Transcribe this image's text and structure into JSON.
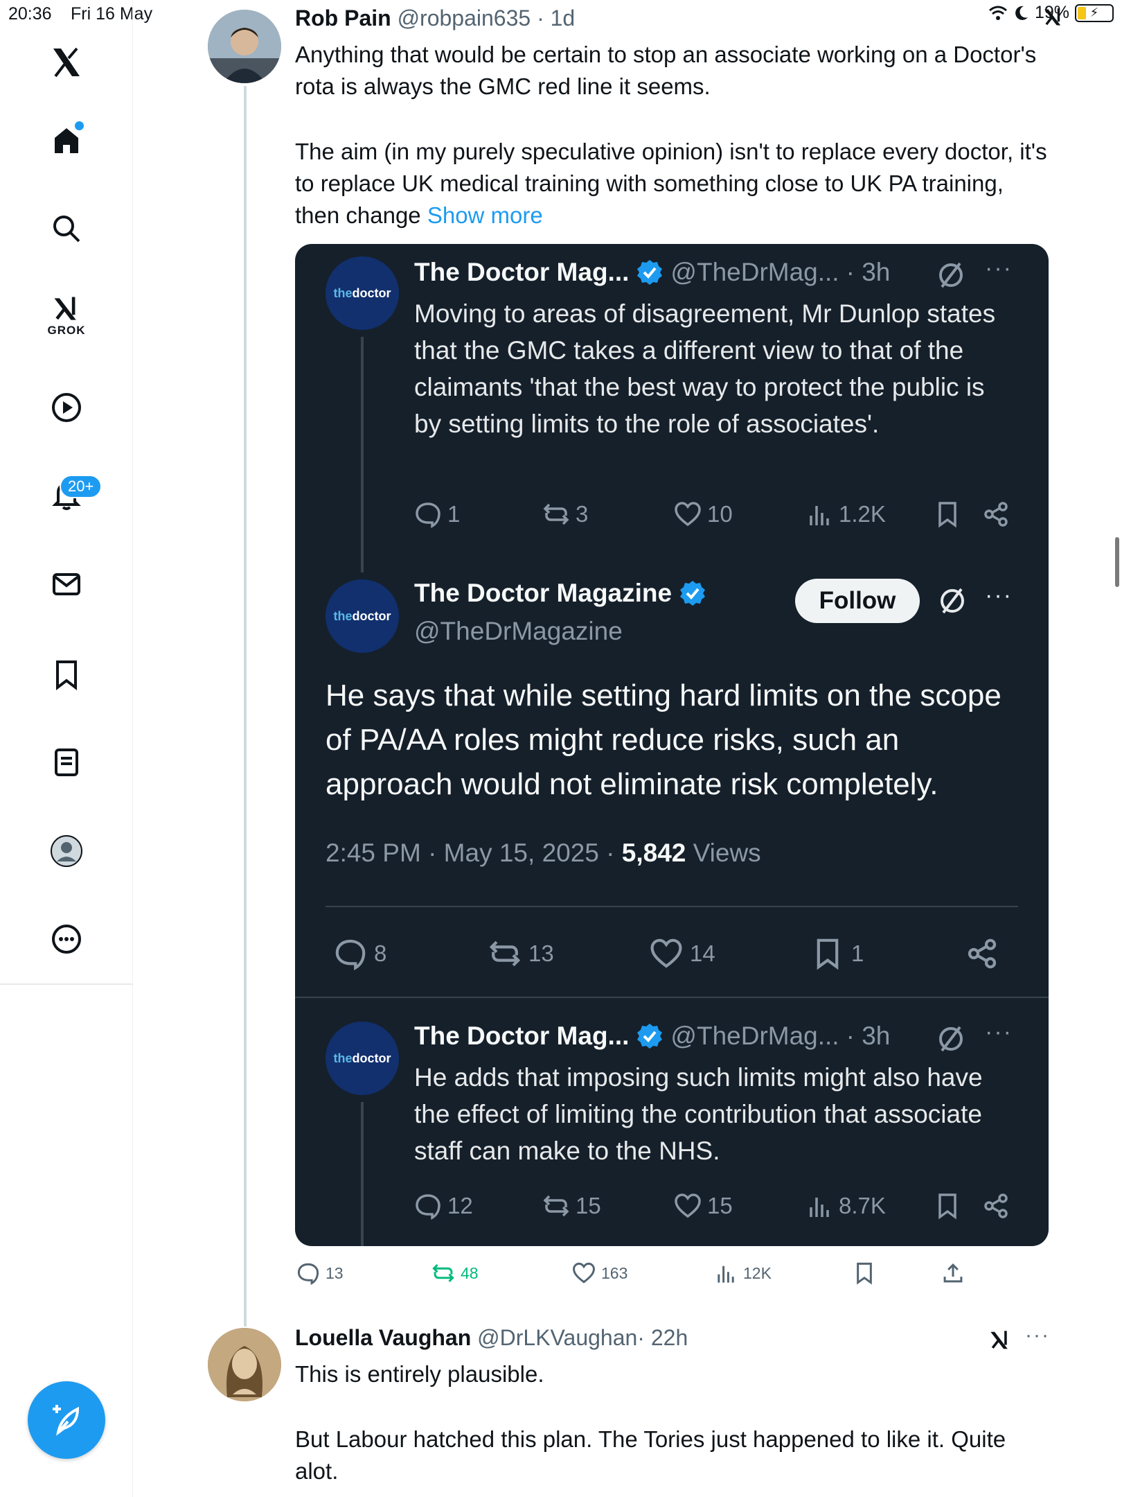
{
  "status_bar": {
    "time": "20:36",
    "date": "Fri 16 May",
    "battery": "19%"
  },
  "nav": {
    "grok_label": "GROK",
    "notifications_badge": "20+"
  },
  "tweet": {
    "name": "Rob Pain",
    "handle": "@robpain635",
    "time": "· 1d",
    "text_p1": "Anything that would be certain to stop an associate working on a Doctor's rota is always the GMC red line it seems.",
    "text_p2": "The aim (in my purely speculative opinion) isn't to replace every doctor, it's to replace UK medical training with something close to UK PA training, then change",
    "show_more": "Show more",
    "actions": {
      "replies": "13",
      "reposts": "48",
      "likes": "163",
      "views": "12K"
    }
  },
  "quote": {
    "avatar_text_a": "the",
    "avatar_text_b": "doctor",
    "top": {
      "name": "The Doctor Mag...",
      "handle": "@TheDrMag...",
      "time": "· 3h",
      "text": "Moving to areas of disagreement, Mr Dunlop states that the GMC takes a different view to that of the claimants 'that the best way to protect the public is by setting limits to the role of associates'.",
      "replies": "1",
      "reposts": "3",
      "likes": "10",
      "views": "1.2K"
    },
    "main": {
      "name": "The Doctor Magazine",
      "handle": "@TheDrMagazine",
      "follow_label": "Follow",
      "text": "He says that while setting hard limits on the scope of PA/AA roles might reduce risks, such an approach would not eliminate risk completely.",
      "timestamp": "2:45 PM · May 15, 2025 · ",
      "views_count": "5,842",
      "views_label": " Views",
      "replies": "8",
      "reposts": "13",
      "likes": "14",
      "bookmarks": "1"
    },
    "bottom": {
      "name": "The Doctor Mag...",
      "handle": "@TheDrMag...",
      "time": "· 3h",
      "text": "He adds that imposing such limits might also have the effect of limiting the contribution that associate staff can make to the NHS.",
      "replies": "12",
      "reposts": "15",
      "likes": "15",
      "views": "8.7K"
    }
  },
  "reply": {
    "name": "Louella Vaughan",
    "handle": "@DrLKVaughan",
    "time": "· 22h",
    "text_p1": "This is entirely plausible.",
    "text_p2": "But Labour hatched this plan. The Tories just happened to like it. Quite alot."
  },
  "colors": {
    "accent": "#1d9bf0",
    "card_bg": "#15202b",
    "repost_green": "#00ba7c"
  }
}
